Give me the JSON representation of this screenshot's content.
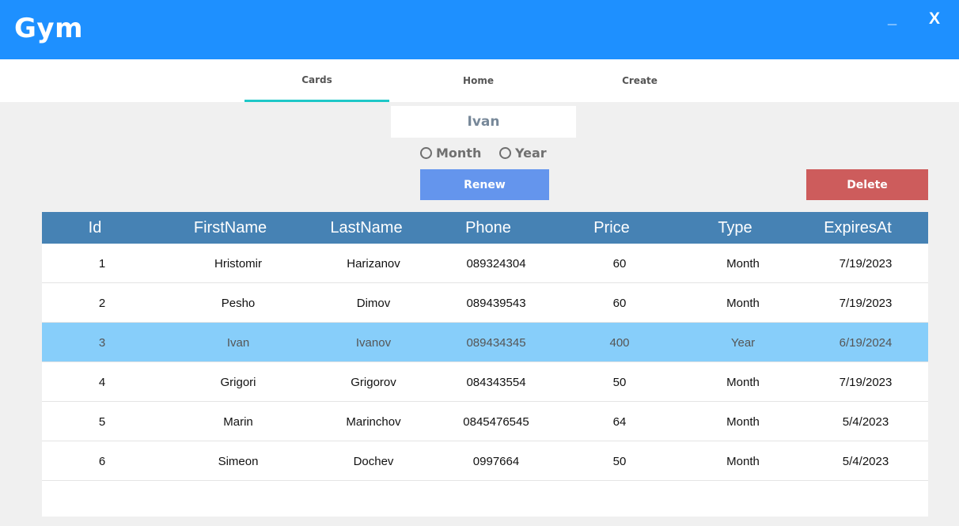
{
  "window": {
    "title": "Gym",
    "minimize_label": "_",
    "close_label": "X"
  },
  "tabs": [
    {
      "label": "Cards",
      "active": true
    },
    {
      "label": "Home",
      "active": false
    },
    {
      "label": "Create",
      "active": false
    }
  ],
  "form": {
    "name_value": "Ivan",
    "radio_month": "Month",
    "radio_year": "Year",
    "renew_label": "Renew",
    "delete_label": "Delete"
  },
  "grid": {
    "columns": [
      "Id",
      "FirstName",
      "LastName",
      "Phone",
      "Price",
      "Type",
      "ExpiresAt"
    ],
    "rows": [
      [
        "1",
        "Hristomir",
        "Harizanov",
        "089324304",
        "60",
        "Month",
        "7/19/2023"
      ],
      [
        "2",
        "Pesho",
        "Dimov",
        "089439543",
        "60",
        "Month",
        "7/19/2023"
      ],
      [
        "3",
        "Ivan",
        "Ivanov",
        "089434345",
        "400",
        "Year",
        "6/19/2024"
      ],
      [
        "4",
        "Grigori",
        "Grigorov",
        "084343554",
        "50",
        "Month",
        "7/19/2023"
      ],
      [
        "5",
        "Marin",
        "Marinchov",
        "0845476545",
        "64",
        "Month",
        "5/4/2023"
      ],
      [
        "6",
        "Simeon",
        "Dochev",
        "0997664",
        "50",
        "Month",
        "5/4/2023"
      ]
    ],
    "selected_row_index": 2
  },
  "colors": {
    "titlebar": "#1e90ff",
    "tab_indicator": "#1ec8c8",
    "renew_button": "#6495ed",
    "delete_button": "#cd5c5c",
    "grid_header": "#4682b4",
    "selected_row": "#87cefa"
  },
  "icons": {
    "minimize": "minimize-icon",
    "close": "close-icon",
    "radio": "radio-circle-icon"
  }
}
